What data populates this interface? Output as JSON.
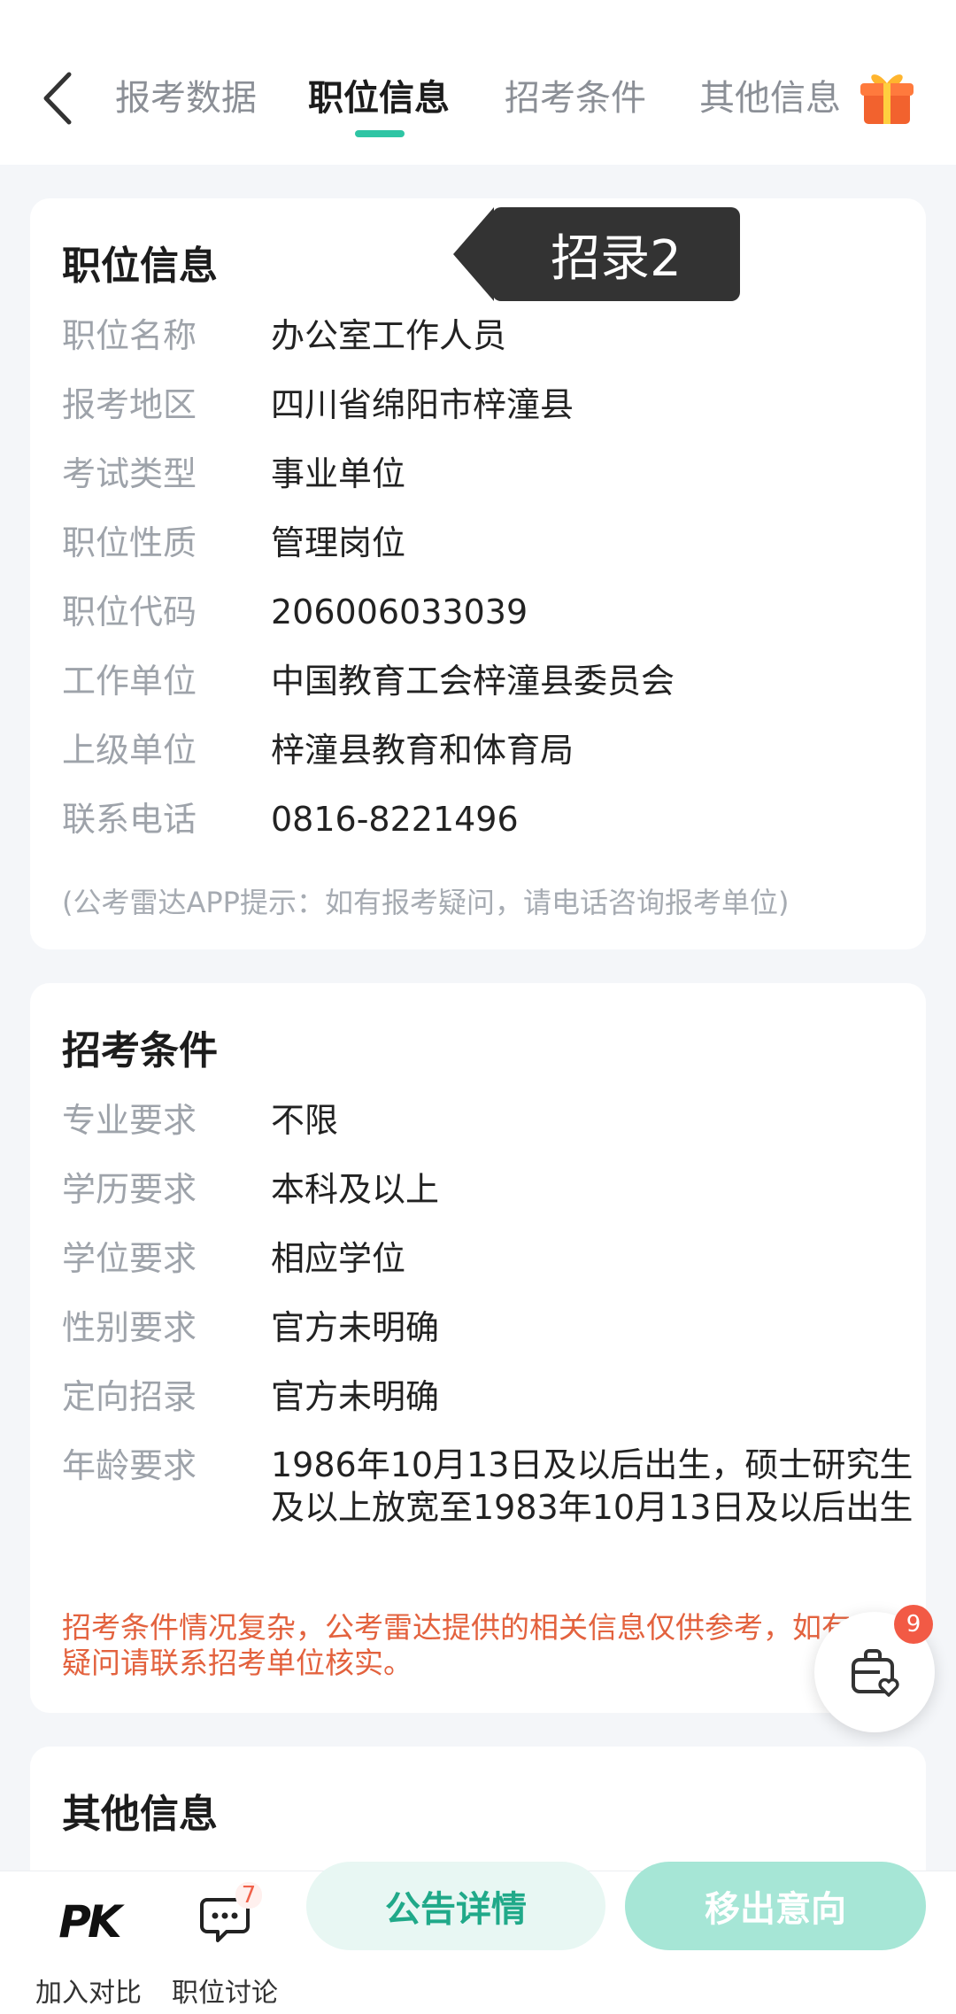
{
  "nav": {
    "tabs": [
      {
        "label": "报考数据"
      },
      {
        "label": "职位信息"
      },
      {
        "label": "招考条件"
      },
      {
        "label": "其他信息"
      }
    ],
    "active_tab": "职位信息"
  },
  "tooltip": {
    "text": "招录2"
  },
  "position_card": {
    "title": "职位信息",
    "rows": [
      {
        "label": "职位名称",
        "value": "办公室工作人员"
      },
      {
        "label": "报考地区",
        "value": "四川省绵阳市梓潼县"
      },
      {
        "label": "考试类型",
        "value": "事业单位"
      },
      {
        "label": "职位性质",
        "value": "管理岗位"
      },
      {
        "label": "职位代码",
        "value": "206006033039"
      },
      {
        "label": "工作单位",
        "value": "中国教育工会梓潼县委员会"
      },
      {
        "label": "上级单位",
        "value": "梓潼县教育和体育局"
      },
      {
        "label": "联系电话",
        "value": "0816-8221496"
      }
    ],
    "hint": "(公考雷达APP提示：如有报考疑问，请电话咨询报考单位)"
  },
  "conditions_card": {
    "title": "招考条件",
    "rows": [
      {
        "label": "专业要求",
        "value": "不限"
      },
      {
        "label": "学历要求",
        "value": "本科及以上"
      },
      {
        "label": "学位要求",
        "value": "相应学位"
      },
      {
        "label": "性别要求",
        "value": "官方未明确"
      },
      {
        "label": "定向招录",
        "value": "官方未明确"
      },
      {
        "label": "年龄要求",
        "value": "1986年10月13日及以后出生，硕士研究生及以上放宽至1983年10月13日及以后出生"
      }
    ],
    "warning": "招考条件情况复杂，公考雷达提供的相关信息仅供参考，如有疑问请联系招考单位核实。"
  },
  "other_card": {
    "title": "其他信息"
  },
  "floating": {
    "badge": "9",
    "icon": "basket-heart-icon"
  },
  "bottom_bar": {
    "compare_icon": "PK",
    "compare_label": "加入对比",
    "discuss_label": "职位讨论",
    "discuss_badge": "7",
    "notice_button": "公告详情",
    "remove_button": "移出意向"
  },
  "colors": {
    "accent": "#2ec5a4",
    "warning": "#e3623e",
    "badge": "#f25a45"
  }
}
